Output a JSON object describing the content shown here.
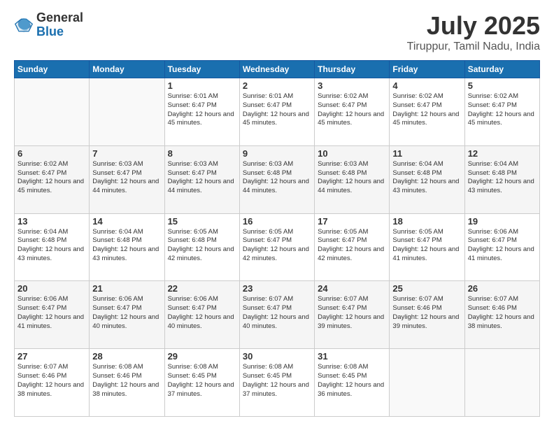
{
  "logo": {
    "general": "General",
    "blue": "Blue"
  },
  "title": {
    "month_year": "July 2025",
    "location": "Tiruppur, Tamil Nadu, India"
  },
  "weekdays": [
    "Sunday",
    "Monday",
    "Tuesday",
    "Wednesday",
    "Thursday",
    "Friday",
    "Saturday"
  ],
  "rows": [
    [
      {
        "day": "",
        "info": ""
      },
      {
        "day": "",
        "info": ""
      },
      {
        "day": "1",
        "info": "Sunrise: 6:01 AM\nSunset: 6:47 PM\nDaylight: 12 hours and 45 minutes."
      },
      {
        "day": "2",
        "info": "Sunrise: 6:01 AM\nSunset: 6:47 PM\nDaylight: 12 hours and 45 minutes."
      },
      {
        "day": "3",
        "info": "Sunrise: 6:02 AM\nSunset: 6:47 PM\nDaylight: 12 hours and 45 minutes."
      },
      {
        "day": "4",
        "info": "Sunrise: 6:02 AM\nSunset: 6:47 PM\nDaylight: 12 hours and 45 minutes."
      },
      {
        "day": "5",
        "info": "Sunrise: 6:02 AM\nSunset: 6:47 PM\nDaylight: 12 hours and 45 minutes."
      }
    ],
    [
      {
        "day": "6",
        "info": "Sunrise: 6:02 AM\nSunset: 6:47 PM\nDaylight: 12 hours and 45 minutes."
      },
      {
        "day": "7",
        "info": "Sunrise: 6:03 AM\nSunset: 6:47 PM\nDaylight: 12 hours and 44 minutes."
      },
      {
        "day": "8",
        "info": "Sunrise: 6:03 AM\nSunset: 6:47 PM\nDaylight: 12 hours and 44 minutes."
      },
      {
        "day": "9",
        "info": "Sunrise: 6:03 AM\nSunset: 6:48 PM\nDaylight: 12 hours and 44 minutes."
      },
      {
        "day": "10",
        "info": "Sunrise: 6:03 AM\nSunset: 6:48 PM\nDaylight: 12 hours and 44 minutes."
      },
      {
        "day": "11",
        "info": "Sunrise: 6:04 AM\nSunset: 6:48 PM\nDaylight: 12 hours and 43 minutes."
      },
      {
        "day": "12",
        "info": "Sunrise: 6:04 AM\nSunset: 6:48 PM\nDaylight: 12 hours and 43 minutes."
      }
    ],
    [
      {
        "day": "13",
        "info": "Sunrise: 6:04 AM\nSunset: 6:48 PM\nDaylight: 12 hours and 43 minutes."
      },
      {
        "day": "14",
        "info": "Sunrise: 6:04 AM\nSunset: 6:48 PM\nDaylight: 12 hours and 43 minutes."
      },
      {
        "day": "15",
        "info": "Sunrise: 6:05 AM\nSunset: 6:48 PM\nDaylight: 12 hours and 42 minutes."
      },
      {
        "day": "16",
        "info": "Sunrise: 6:05 AM\nSunset: 6:47 PM\nDaylight: 12 hours and 42 minutes."
      },
      {
        "day": "17",
        "info": "Sunrise: 6:05 AM\nSunset: 6:47 PM\nDaylight: 12 hours and 42 minutes."
      },
      {
        "day": "18",
        "info": "Sunrise: 6:05 AM\nSunset: 6:47 PM\nDaylight: 12 hours and 41 minutes."
      },
      {
        "day": "19",
        "info": "Sunrise: 6:06 AM\nSunset: 6:47 PM\nDaylight: 12 hours and 41 minutes."
      }
    ],
    [
      {
        "day": "20",
        "info": "Sunrise: 6:06 AM\nSunset: 6:47 PM\nDaylight: 12 hours and 41 minutes."
      },
      {
        "day": "21",
        "info": "Sunrise: 6:06 AM\nSunset: 6:47 PM\nDaylight: 12 hours and 40 minutes."
      },
      {
        "day": "22",
        "info": "Sunrise: 6:06 AM\nSunset: 6:47 PM\nDaylight: 12 hours and 40 minutes."
      },
      {
        "day": "23",
        "info": "Sunrise: 6:07 AM\nSunset: 6:47 PM\nDaylight: 12 hours and 40 minutes."
      },
      {
        "day": "24",
        "info": "Sunrise: 6:07 AM\nSunset: 6:47 PM\nDaylight: 12 hours and 39 minutes."
      },
      {
        "day": "25",
        "info": "Sunrise: 6:07 AM\nSunset: 6:46 PM\nDaylight: 12 hours and 39 minutes."
      },
      {
        "day": "26",
        "info": "Sunrise: 6:07 AM\nSunset: 6:46 PM\nDaylight: 12 hours and 38 minutes."
      }
    ],
    [
      {
        "day": "27",
        "info": "Sunrise: 6:07 AM\nSunset: 6:46 PM\nDaylight: 12 hours and 38 minutes."
      },
      {
        "day": "28",
        "info": "Sunrise: 6:08 AM\nSunset: 6:46 PM\nDaylight: 12 hours and 38 minutes."
      },
      {
        "day": "29",
        "info": "Sunrise: 6:08 AM\nSunset: 6:45 PM\nDaylight: 12 hours and 37 minutes."
      },
      {
        "day": "30",
        "info": "Sunrise: 6:08 AM\nSunset: 6:45 PM\nDaylight: 12 hours and 37 minutes."
      },
      {
        "day": "31",
        "info": "Sunrise: 6:08 AM\nSunset: 6:45 PM\nDaylight: 12 hours and 36 minutes."
      },
      {
        "day": "",
        "info": ""
      },
      {
        "day": "",
        "info": ""
      }
    ]
  ]
}
